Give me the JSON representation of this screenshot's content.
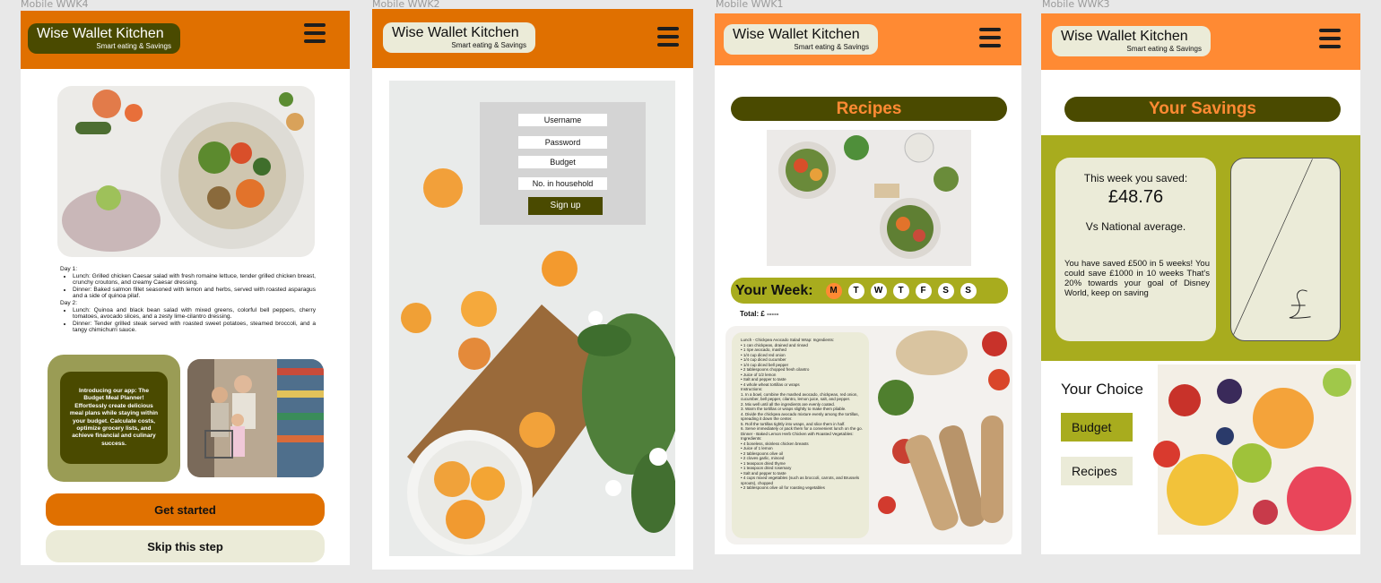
{
  "frames": {
    "wwk4": {
      "label": "Mobile WWK4"
    },
    "wwk2": {
      "label": "Mobile WWK2"
    },
    "wwk1": {
      "label": "Mobile WWK1"
    },
    "wwk3": {
      "label": "Mobile WWK3"
    }
  },
  "brand": {
    "title": "Wise Wallet Kitchen",
    "subtitle": "Smart eating & Savings"
  },
  "colors": {
    "orange": "#e07000",
    "light_orange": "#ff8a33",
    "olive": "#4a4a00",
    "olive_green": "#a8ac1e",
    "cream": "#ebebd8",
    "sage": "#9a9c55"
  },
  "icons": {
    "menu": "hamburger-menu-icon"
  },
  "home": {
    "meal_plan": {
      "day1_title": "Day 1:",
      "day1": [
        "Lunch: Grilled chicken Caesar salad with fresh romaine lettuce, tender grilled chicken breast, crunchy croutons, and creamy Caesar dressing.",
        "Dinner: Baked salmon fillet seasoned with lemon and herbs, served with roasted asparagus and a side of quinoa pilaf."
      ],
      "day2_title": "Day 2:",
      "day2": [
        "Lunch: Quinoa and black bean salad with mixed greens, colorful bell peppers, cherry tomatoes, avocado slices, and a zesty lime-cilantro dressing.",
        "Dinner: Tender grilled steak served with roasted sweet potatoes, steamed broccoli, and a tangy chimichurri sauce."
      ]
    },
    "intro_text": "Introducing our app: The Budget Meal Planner! Effortlessly create delicious meal plans while staying within your budget. Calculate costs, optimize grocery lists, and achieve financial and culinary success.",
    "get_started": "Get started",
    "skip": "Skip this step"
  },
  "signup": {
    "username": "Username",
    "password": "Password",
    "budget": "Budget",
    "household": "No. in household",
    "submit": "Sign up"
  },
  "recipes": {
    "title": "Recipes",
    "week_label": "Your Week:",
    "days": [
      "M",
      "T",
      "W",
      "T",
      "F",
      "S",
      "S"
    ],
    "total": "Total: £ -----",
    "recipe_lines": [
      "Lunch - Chickpea Avocado Salad Wrap: Ingredients:",
      "• 1 can chickpeas, drained and rinsed",
      "• 1 ripe avocado, mashed",
      "• 1/4 cup diced red onion",
      "• 1/4 cup diced cucumber",
      "• 1/4 cup diced bell pepper",
      "• 2 tablespoons chopped fresh cilantro",
      "• Juice of 1/2 lemon",
      "• Salt and pepper to taste",
      "• 4 whole wheat tortillas or wraps",
      "Instructions:",
      "1. In a bowl, combine the mashed avocado, chickpeas, red onion, cucumber, bell pepper, cilantro, lemon juice, salt, and pepper.",
      "2. Mix well until all the ingredients are evenly coated.",
      "3. Warm the tortillas or wraps slightly to make them pliable.",
      "4. Divide the chickpea avocado mixture evenly among the tortillas, spreading it down the center.",
      "5. Roll the tortillas tightly into wraps, and slice them in half.",
      "6. Serve immediately or pack them for a convenient lunch on the go.",
      "Dinner - Baked Lemon Herb Chicken with Roasted Vegetables: Ingredients:",
      "• 4 boneless, skinless chicken breasts",
      "• Juice of 1 lemon",
      "• 2 tablespoons olive oil",
      "• 2 cloves garlic, minced",
      "• 1 teaspoon dried thyme",
      "• 1 teaspoon dried rosemary",
      "• Salt and pepper to taste",
      "• 4 cups mixed vegetables (such as broccoli, carrots, and Brussels sprouts), chopped",
      "• 2 tablespoons olive oil for roasting vegetables"
    ]
  },
  "savings": {
    "title": "Your Savings",
    "week_label": "This week you saved:",
    "amount": "£48.76",
    "compare": "Vs National average.",
    "summary": "You have saved £500 in 5 weeks! You could save £1000 in 10 weeks That's 20% towards your goal of Disney World, keep on saving",
    "choice_title": "Your Choice",
    "budget_btn": "Budget",
    "recipes_btn": "Recipes"
  }
}
